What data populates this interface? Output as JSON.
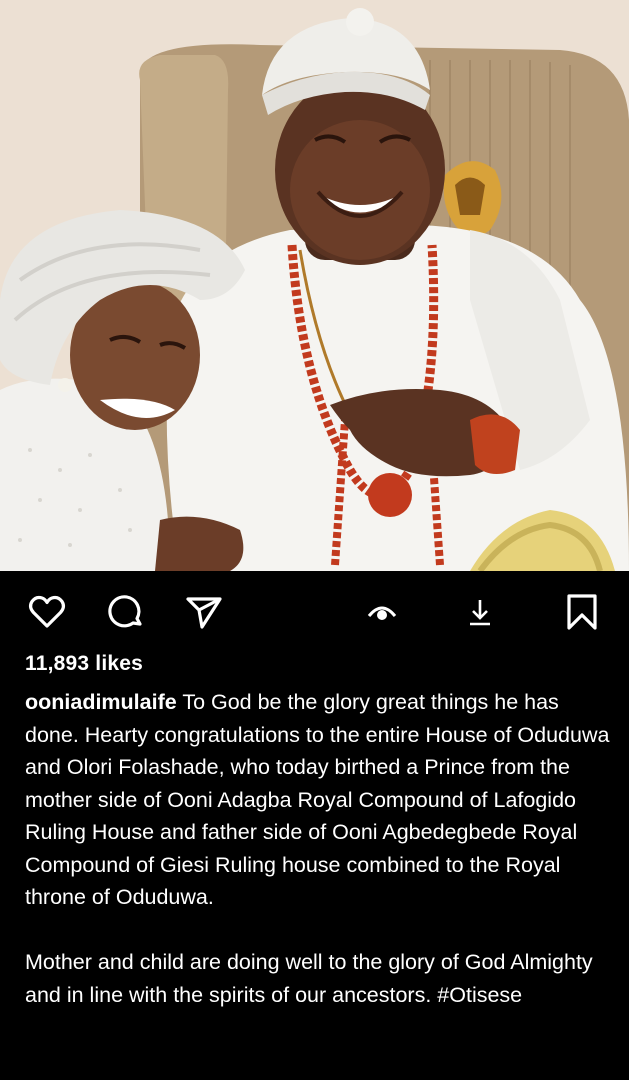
{
  "post": {
    "image_alt": "Ooni of Ife laughing next to Olori Folashade",
    "likes": "11,893 likes",
    "username": "ooniadimulaife",
    "caption_p1": "To God be the glory great things he has done. Hearty congratulations to the entire House of Oduduwa and Olori Folashade, who today birthed a Prince from the mother side of Ooni Adagba Royal Compound of Lafogido Ruling House and father side of Ooni Agbedegbede Royal Compound of Giesi Ruling house combined to the Royal throne of Oduduwa.",
    "caption_p2": "Mother and child are doing well to the glory of God Almighty and in line with the spirits of our ancestors. #Otisese"
  },
  "actions": {
    "like_icon": "heart-icon",
    "comment_icon": "comment-icon",
    "share_icon": "send-icon",
    "view_icon": "eye-icon",
    "download_icon": "download-icon",
    "save_icon": "bookmark-icon"
  },
  "colors": {
    "background": "#000000",
    "text": "#ffffff"
  }
}
